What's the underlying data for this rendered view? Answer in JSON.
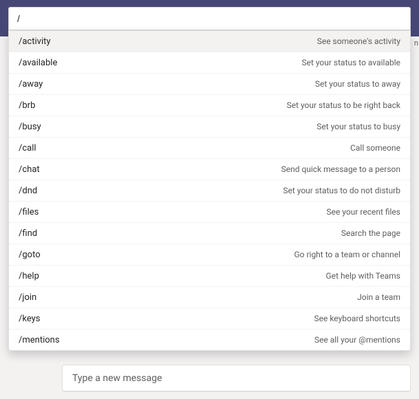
{
  "search": {
    "value": "/"
  },
  "commands": [
    {
      "name": "/activity",
      "desc": "See someone's activity",
      "highlight": true
    },
    {
      "name": "/available",
      "desc": "Set your status to available",
      "highlight": false
    },
    {
      "name": "/away",
      "desc": "Set your status to away",
      "highlight": false
    },
    {
      "name": "/brb",
      "desc": "Set your status to be right back",
      "highlight": false
    },
    {
      "name": "/busy",
      "desc": "Set your status to busy",
      "highlight": false
    },
    {
      "name": "/call",
      "desc": "Call someone",
      "highlight": false
    },
    {
      "name": "/chat",
      "desc": "Send quick message to a person",
      "highlight": false
    },
    {
      "name": "/dnd",
      "desc": "Set your status to do not disturb",
      "highlight": false
    },
    {
      "name": "/files",
      "desc": "See your recent files",
      "highlight": false
    },
    {
      "name": "/find",
      "desc": "Search the page",
      "highlight": false
    },
    {
      "name": "/goto",
      "desc": "Go right to a team or channel",
      "highlight": false
    },
    {
      "name": "/help",
      "desc": "Get help with Teams",
      "highlight": false
    },
    {
      "name": "/join",
      "desc": "Join a team",
      "highlight": false
    },
    {
      "name": "/keys",
      "desc": "See keyboard shortcuts",
      "highlight": false
    },
    {
      "name": "/mentions",
      "desc": "See all your @mentions",
      "highlight": false
    }
  ],
  "compose": {
    "placeholder": "Type a new message"
  },
  "edge_letter": "n",
  "colors": {
    "header": "#464775",
    "text_primary": "#252423",
    "text_secondary": "#605e5c",
    "bg": "#f3f2f1"
  }
}
